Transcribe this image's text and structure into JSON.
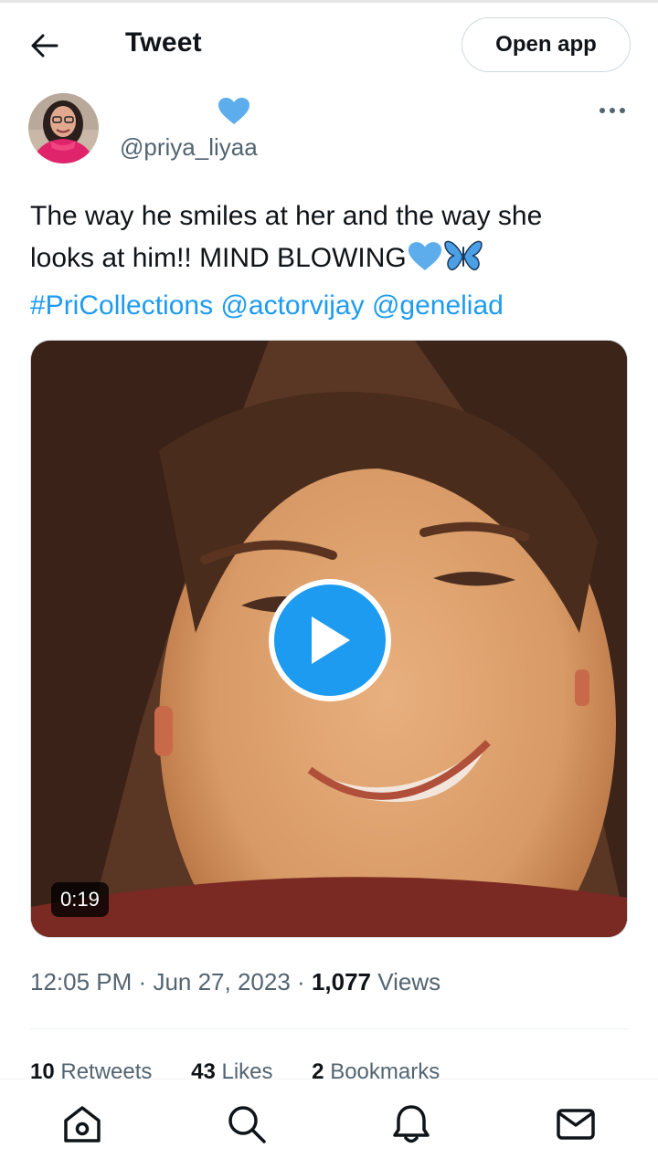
{
  "header": {
    "title": "Tweet",
    "open_app_label": "Open app",
    "back_icon": "arrow-left-icon"
  },
  "author": {
    "handle": "@priya_liyaa",
    "badge_icon": "blue-heart-icon",
    "more_icon": "more-horizontal-icon"
  },
  "tweet": {
    "line1": "The way he smiles at her and the way she",
    "line2_text": "looks at him!!  MIND BLOWING",
    "line2_emojis": [
      "blue-heart",
      "butterfly"
    ],
    "hashtag": "#PriCollections",
    "mention1": "@actorvijay",
    "mention2": "@geneliad"
  },
  "media": {
    "type": "video",
    "duration": "0:19",
    "play_icon": "play-icon"
  },
  "meta": {
    "time": "12:05 PM",
    "date": "Jun 27, 2023",
    "separator": "·",
    "views_count": "1,077",
    "views_label": "Views"
  },
  "stats": [
    {
      "count": "10",
      "label": "Retweets"
    },
    {
      "count": "43",
      "label": "Likes"
    },
    {
      "count": "2",
      "label": "Bookmarks"
    }
  ],
  "bottom_nav": {
    "items": [
      "home-icon",
      "search-icon",
      "notifications-bell-icon",
      "messages-envelope-icon"
    ]
  },
  "colors": {
    "accent": "#1d9bf0",
    "text": "#0f1419",
    "secondary": "#536471",
    "heart": "#5dadec"
  }
}
